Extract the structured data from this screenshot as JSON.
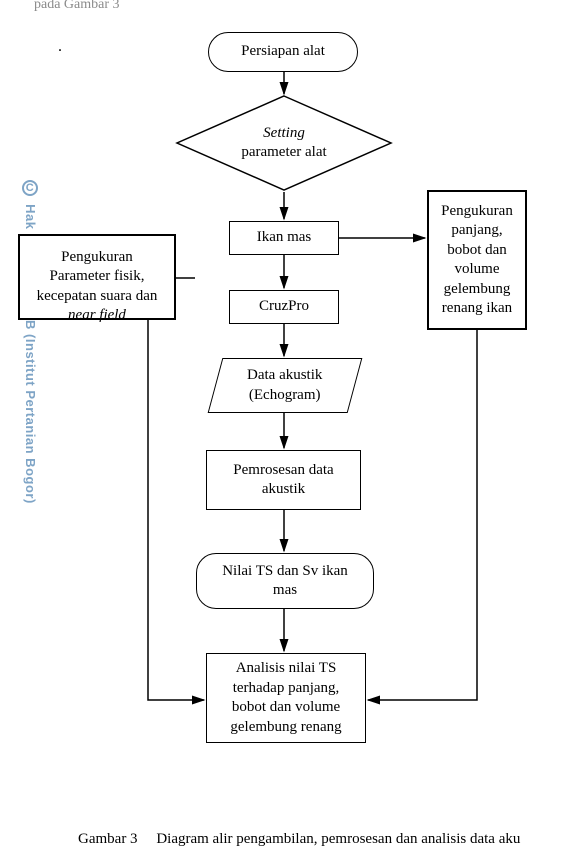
{
  "header_fragment": "pada Gambar 3",
  "dot": ".",
  "watermark": "Hak cipta milik IPB (Institut Pertanian Bogor)",
  "caption_prefix": "Gambar 3",
  "caption_text": "Diagram alir pengambilan, pemrosesan dan analisis data aku",
  "flow": {
    "terminator_start": "Persiapan alat",
    "decision_line1": "Setting",
    "decision_line2": "parameter alat",
    "proc_ikan": "Ikan mas",
    "proc_cruz": "CruzPro",
    "data_line1": "Data   akustik",
    "data_line2": "(Echogram)",
    "proc_prose": "Pemrosesan data\nakustik",
    "rounded_nilai": "Nilai TS dan Sv ikan\nmas",
    "proc_analisis": "Analisis nilai TS\nterhadap panjang,\nbobot dan volume\ngelembung renang"
  },
  "side_left": "Pengukuran\nParameter fisik,\nkecepatan suara dan\nnear field",
  "side_left_italic_word": "near field",
  "side_right": "Pengukuran\npanjang,\nbobot dan\nvolume\ngelembung\nrenang ikan"
}
